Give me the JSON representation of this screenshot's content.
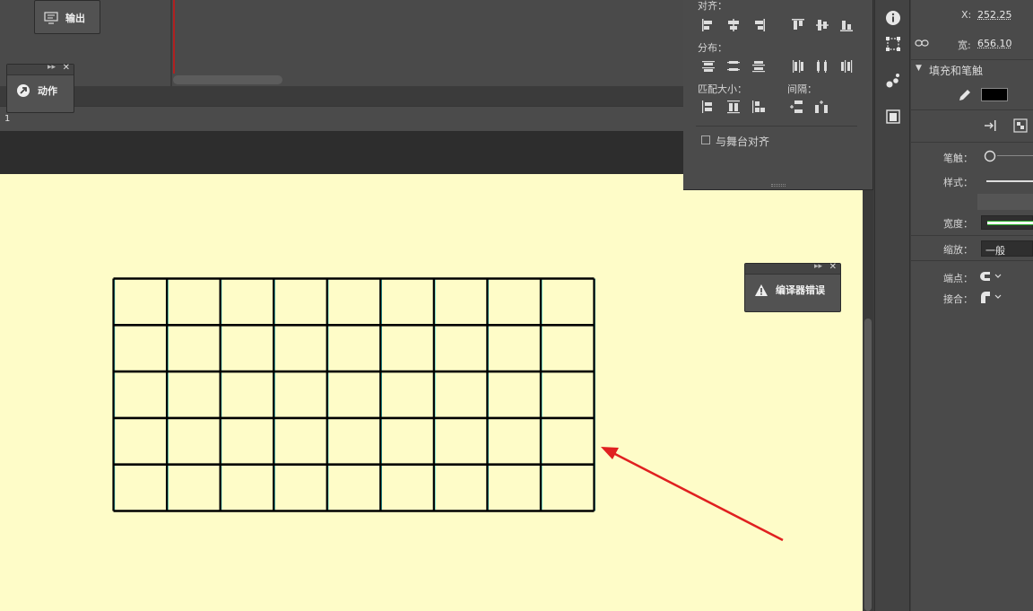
{
  "timeline": {
    "output_label": "输出",
    "action_label": "动作",
    "frame_number": "1"
  },
  "align_panel": {
    "align_label": "对齐：",
    "distribute_label": "分布：",
    "match_size_label": "匹配大小：",
    "spacing_label": "间隔：",
    "stage_align_label": "与舞台对齐"
  },
  "compiler_panel": {
    "label": "编译器错误"
  },
  "properties": {
    "x_label": "X:",
    "x_value": "252.25",
    "width_label": "宽:",
    "width_value": "656.10",
    "fill_stroke_header": "填充和笔触",
    "stroke_label": "笔触：",
    "style_label": "样式：",
    "stroke_width_label": "宽度：",
    "scale_label": "缩放：",
    "scale_value": "一般",
    "cap_label": "端点：",
    "join_label": "接合：",
    "fill_color": "#000000"
  },
  "grid": {
    "rows": 5,
    "cols": 9
  },
  "colors": {
    "stage": "#fefcc8",
    "arrow": "#e02020",
    "grid_line": "#000000",
    "grid_highlight": "#2ec4c4"
  }
}
